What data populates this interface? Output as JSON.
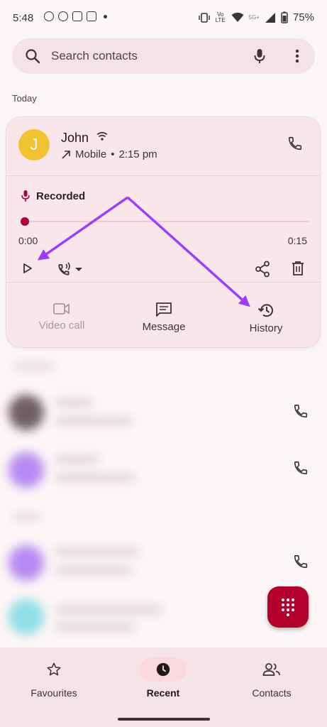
{
  "status_bar": {
    "time": "5:48",
    "network_label": "5G+",
    "volte_label": "Vo LTE",
    "battery": "75%"
  },
  "search": {
    "placeholder": "Search contacts"
  },
  "recent": {
    "section_label": "Today",
    "expanded_entry": {
      "avatar_letter": "J",
      "name": "John",
      "call_type": "Mobile",
      "separator": "•",
      "time": "2:15 pm",
      "recording_label": "Recorded",
      "position": "0:00",
      "duration": "0:15",
      "playback_progress": 0,
      "actions": [
        {
          "label": "Video call",
          "enabled": false
        },
        {
          "label": "Message",
          "enabled": true
        },
        {
          "label": "History",
          "enabled": true
        }
      ]
    }
  },
  "bottom_nav": {
    "items": [
      {
        "label": "Favourites",
        "active": false
      },
      {
        "label": "Recent",
        "active": true
      },
      {
        "label": "Contacts",
        "active": false
      }
    ]
  },
  "colors": {
    "accent": "#b4002f",
    "avatar": "#f1c232",
    "annotation_arrow": "#9b3dfc",
    "card_bg": "#f8e6ea"
  },
  "icons": [
    "search-icon",
    "mic-icon",
    "more-vert-icon",
    "wifi-calling-icon",
    "outgoing-call-icon",
    "phone-icon",
    "record-mic-icon",
    "play-icon",
    "speaker-icon",
    "share-icon",
    "delete-icon",
    "video-call-icon",
    "message-icon",
    "history-icon",
    "dialpad-icon",
    "star-icon",
    "clock-icon",
    "contacts-icon"
  ]
}
